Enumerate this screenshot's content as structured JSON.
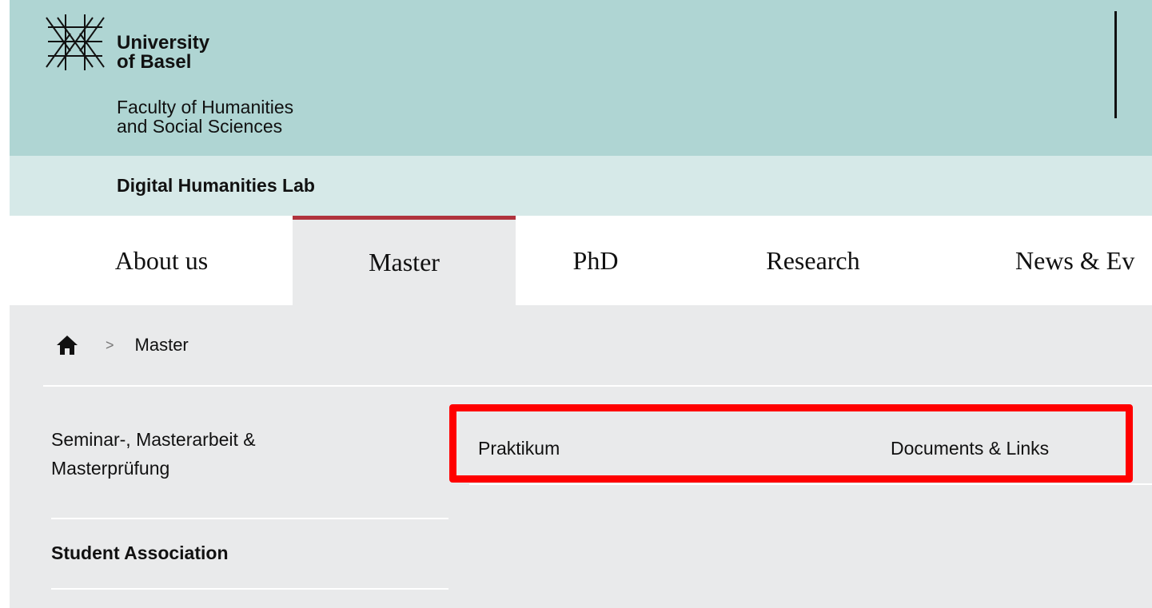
{
  "header": {
    "university_line1": "University",
    "university_line2": "of Basel",
    "faculty_line1": "Faculty of Humanities",
    "faculty_line2": "and Social Sciences",
    "lab_name": "Digital Humanities Lab"
  },
  "topnav": {
    "items": [
      {
        "label": "About us"
      },
      {
        "label": "Master",
        "active": true
      },
      {
        "label": "PhD"
      },
      {
        "label": "Research"
      },
      {
        "label": "News & Ev"
      }
    ]
  },
  "breadcrumb": {
    "icon": "home-icon",
    "separator": ">",
    "current": "Master"
  },
  "sidebar": {
    "items": [
      {
        "label_line1": "Seminar-, Masterarbeit &",
        "label_line2": "Masterprüfung"
      },
      {
        "label": "Student Association"
      }
    ]
  },
  "subnav": {
    "items": [
      {
        "label": "Praktikum"
      },
      {
        "label": "Documents & Links"
      }
    ],
    "highlight_color": "#ff0000"
  },
  "colors": {
    "header_bg": "#afd5d3",
    "subheader_bg": "#d6e9e8",
    "content_bg": "#e9eaeb",
    "active_accent": "#b0333d"
  }
}
